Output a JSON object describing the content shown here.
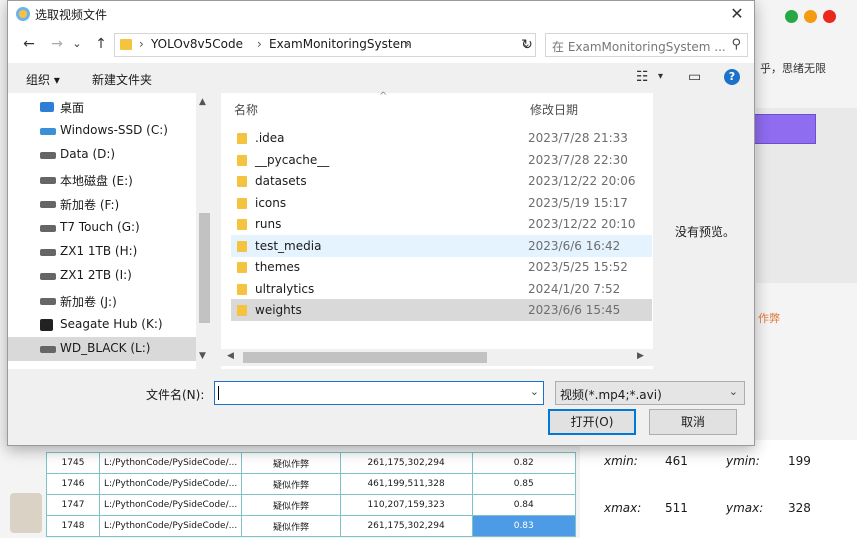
{
  "background_app": {
    "right_text": "乎，思绪无限",
    "link_text": "作弊",
    "preview_empty": "没有预览。",
    "coords": {
      "xmin_label": "xmin:",
      "xmin_value": "461",
      "ymin_label": "ymin:",
      "ymin_value": "199",
      "xmax_label": "xmax:",
      "xmax_value": "511",
      "ymax_label": "ymax:",
      "ymax_value": "328"
    },
    "table_rows": [
      {
        "id": "1745",
        "path": "L:/PythonCode/PySideCode/...",
        "type": "疑似作弊",
        "box": "261,175,302,294",
        "score": "0.82"
      },
      {
        "id": "1746",
        "path": "L:/PythonCode/PySideCode/...",
        "type": "疑似作弊",
        "box": "461,199,511,328",
        "score": "0.85"
      },
      {
        "id": "1747",
        "path": "L:/PythonCode/PySideCode/...",
        "type": "疑似作弊",
        "box": "110,207,159,323",
        "score": "0.84"
      },
      {
        "id": "1748",
        "path": "L:/PythonCode/PySideCode/...",
        "type": "疑似作弊",
        "box": "261,175,302,294",
        "score": "0.83"
      }
    ],
    "colors": {
      "close": "#e8291c",
      "minimize": "#f39c12",
      "maximize": "#27a844",
      "accent": "#8f6cf0"
    }
  },
  "dialog": {
    "title": "选取视频文件",
    "close_label": "✕",
    "nav": {
      "back": "←",
      "forward": "→",
      "recent": "⌄",
      "up": "↑",
      "path": [
        "YOLOv8v5Code",
        "ExamMonitoringSystem"
      ],
      "refresh": "↻",
      "search_placeholder": "在 ExamMonitoringSystem ..."
    },
    "toolbar": {
      "organize": "组织 ▾",
      "new_folder": "新建文件夹",
      "help": "?"
    },
    "nav_pane": [
      {
        "label": "桌面",
        "icon": "desktop-icon",
        "state": "normal"
      },
      {
        "label": "Windows-SSD (C:)",
        "icon": "windows-drive-icon",
        "state": "normal"
      },
      {
        "label": "Data (D:)",
        "icon": "drive-icon",
        "state": "normal"
      },
      {
        "label": "本地磁盘 (E:)",
        "icon": "drive-icon",
        "state": "normal"
      },
      {
        "label": "新加卷 (F:)",
        "icon": "drive-icon",
        "state": "normal"
      },
      {
        "label": "T7 Touch (G:)",
        "icon": "drive-icon",
        "state": "normal"
      },
      {
        "label": "ZX1 1TB (H:)",
        "icon": "drive-icon",
        "state": "normal"
      },
      {
        "label": "ZX1 2TB (I:)",
        "icon": "drive-icon",
        "state": "normal"
      },
      {
        "label": "新加卷 (J:)",
        "icon": "drive-icon",
        "state": "normal"
      },
      {
        "label": "Seagate Hub (K:)",
        "icon": "external-drive-icon",
        "state": "normal"
      },
      {
        "label": "WD_BLACK (L:)",
        "icon": "drive-icon",
        "state": "hover"
      }
    ],
    "columns": {
      "name": "名称",
      "modified": "修改日期"
    },
    "files": [
      {
        "name": ".idea",
        "date": "2023/7/28 21:33",
        "state": "normal"
      },
      {
        "name": "__pycache__",
        "date": "2023/7/28 22:30",
        "state": "normal"
      },
      {
        "name": "datasets",
        "date": "2023/12/22 20:06",
        "state": "normal"
      },
      {
        "name": "icons",
        "date": "2023/5/19 15:17",
        "state": "normal"
      },
      {
        "name": "runs",
        "date": "2023/12/22 20:10",
        "state": "normal"
      },
      {
        "name": "test_media",
        "date": "2023/6/6 16:42",
        "state": "hover"
      },
      {
        "name": "themes",
        "date": "2023/5/25 15:52",
        "state": "normal"
      },
      {
        "name": "ultralytics",
        "date": "2024/1/20 7:52",
        "state": "normal"
      },
      {
        "name": "weights",
        "date": "2023/6/6 15:45",
        "state": "selected"
      }
    ],
    "filename_label": "文件名(N):",
    "filename_value": "",
    "filetype_value": "视频(*.mp4;*.avi)",
    "open_button": "打开(O)",
    "cancel_button": "取消"
  }
}
